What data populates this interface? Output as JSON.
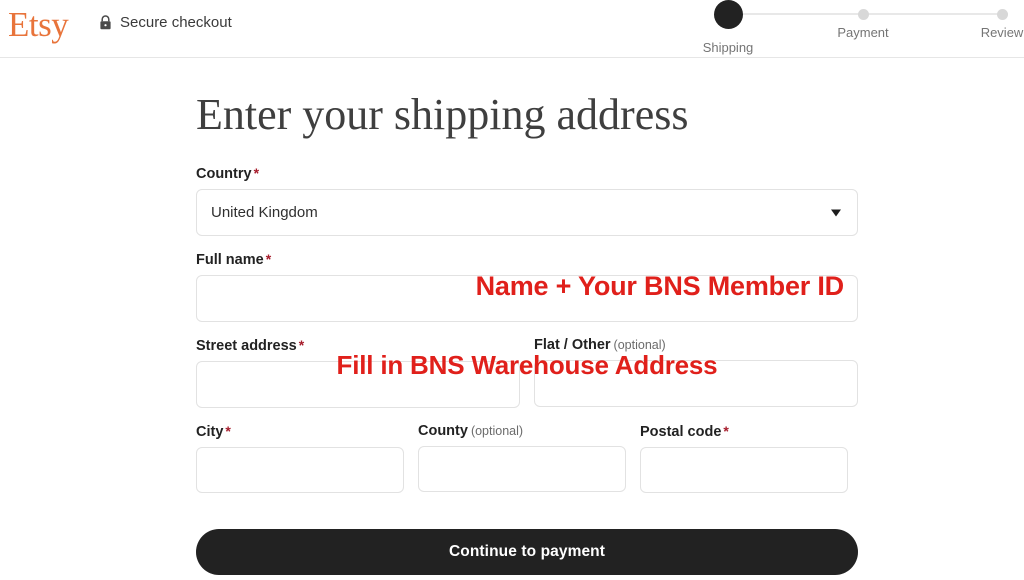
{
  "header": {
    "brand": "Etsy",
    "secure_label": "Secure checkout",
    "lock_icon": "lock-icon"
  },
  "stepper": {
    "steps": [
      {
        "label": "Shipping",
        "state": "active"
      },
      {
        "label": "Payment",
        "state": "upcoming"
      },
      {
        "label": "Review",
        "state": "upcoming"
      }
    ]
  },
  "form": {
    "title": "Enter your shipping address",
    "country": {
      "label": "Country",
      "required_mark": "*",
      "value": "United Kingdom",
      "caret_icon": "chevron-down-icon"
    },
    "full_name": {
      "label": "Full name",
      "required_mark": "*",
      "value": "",
      "annotation": "Name + Your BNS Member ID"
    },
    "street_address": {
      "label": "Street address",
      "required_mark": "*",
      "value": ""
    },
    "flat_other": {
      "label": "Flat / Other",
      "optional_note": "(optional)",
      "value": ""
    },
    "street_annotation": "Fill in BNS Warehouse Address",
    "city": {
      "label": "City",
      "required_mark": "*",
      "value": ""
    },
    "county": {
      "label": "County",
      "optional_note": "(optional)",
      "value": ""
    },
    "postal_code": {
      "label": "Postal code",
      "required_mark": "*",
      "value": ""
    },
    "submit_label": "Continue to payment"
  },
  "colors": {
    "brand_orange": "#e8743b",
    "annotation_red": "#e0201b",
    "required_star": "#a61c2b",
    "button_dark": "#222222",
    "step_active": "#222222",
    "step_inactive": "#d8d8d8"
  }
}
